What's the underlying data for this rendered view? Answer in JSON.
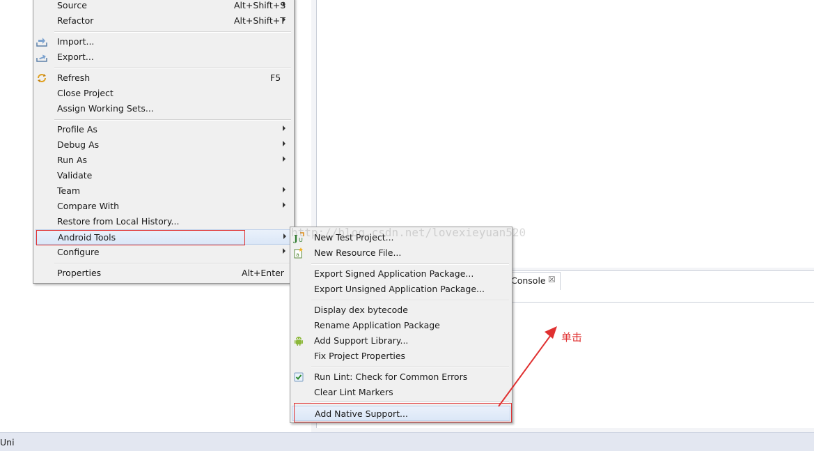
{
  "context_menu": {
    "items": [
      {
        "label": "Source",
        "accelerator": "Alt+Shift+S",
        "submenu": true
      },
      {
        "label": "Refactor",
        "accelerator": "Alt+Shift+T",
        "submenu": true
      },
      {
        "label": "Import...",
        "icon": "import-icon"
      },
      {
        "label": "Export...",
        "icon": "export-icon"
      },
      {
        "label": "Refresh",
        "accelerator": "F5",
        "icon": "refresh-icon"
      },
      {
        "label": "Close Project"
      },
      {
        "label": "Assign Working Sets..."
      },
      {
        "label": "Profile As",
        "submenu": true
      },
      {
        "label": "Debug As",
        "submenu": true
      },
      {
        "label": "Run As",
        "submenu": true
      },
      {
        "label": "Validate"
      },
      {
        "label": "Team",
        "submenu": true
      },
      {
        "label": "Compare With",
        "submenu": true
      },
      {
        "label": "Restore from Local History..."
      },
      {
        "label": "Android Tools",
        "submenu": true,
        "highlighted": true
      },
      {
        "label": "Configure",
        "submenu": true
      },
      {
        "label": "Properties",
        "accelerator": "Alt+Enter"
      }
    ]
  },
  "android_tools_submenu": {
    "items": [
      {
        "label": "New Test Project...",
        "icon": "junit-test-icon"
      },
      {
        "label": "New Resource File...",
        "icon": "new-android-xml-file-icon"
      },
      {
        "label": "Export Signed Application Package..."
      },
      {
        "label": "Export Unsigned Application Package..."
      },
      {
        "label": "Display dex bytecode"
      },
      {
        "label": "Rename Application Package"
      },
      {
        "label": "Add Support Library...",
        "icon": "android-robot-icon"
      },
      {
        "label": "Fix Project Properties"
      },
      {
        "label": "Run Lint: Check for Common Errors",
        "icon": "lint-check-icon"
      },
      {
        "label": "Clear Lint Markers"
      },
      {
        "label": "Add Native Support...",
        "highlighted": true
      }
    ]
  },
  "console": {
    "tab_label": "Console",
    "close_glyph": "☒"
  },
  "status_bar": {
    "text": "Uni"
  },
  "watermark": "http://blog.csdn.net/lovexieyuan520",
  "annotation": {
    "text": "单击",
    "color": "#e03030"
  },
  "colors": {
    "annotation_red": "#e03030",
    "menu_bg": "#f0f0f0",
    "highlight": "#dbe7f7"
  }
}
